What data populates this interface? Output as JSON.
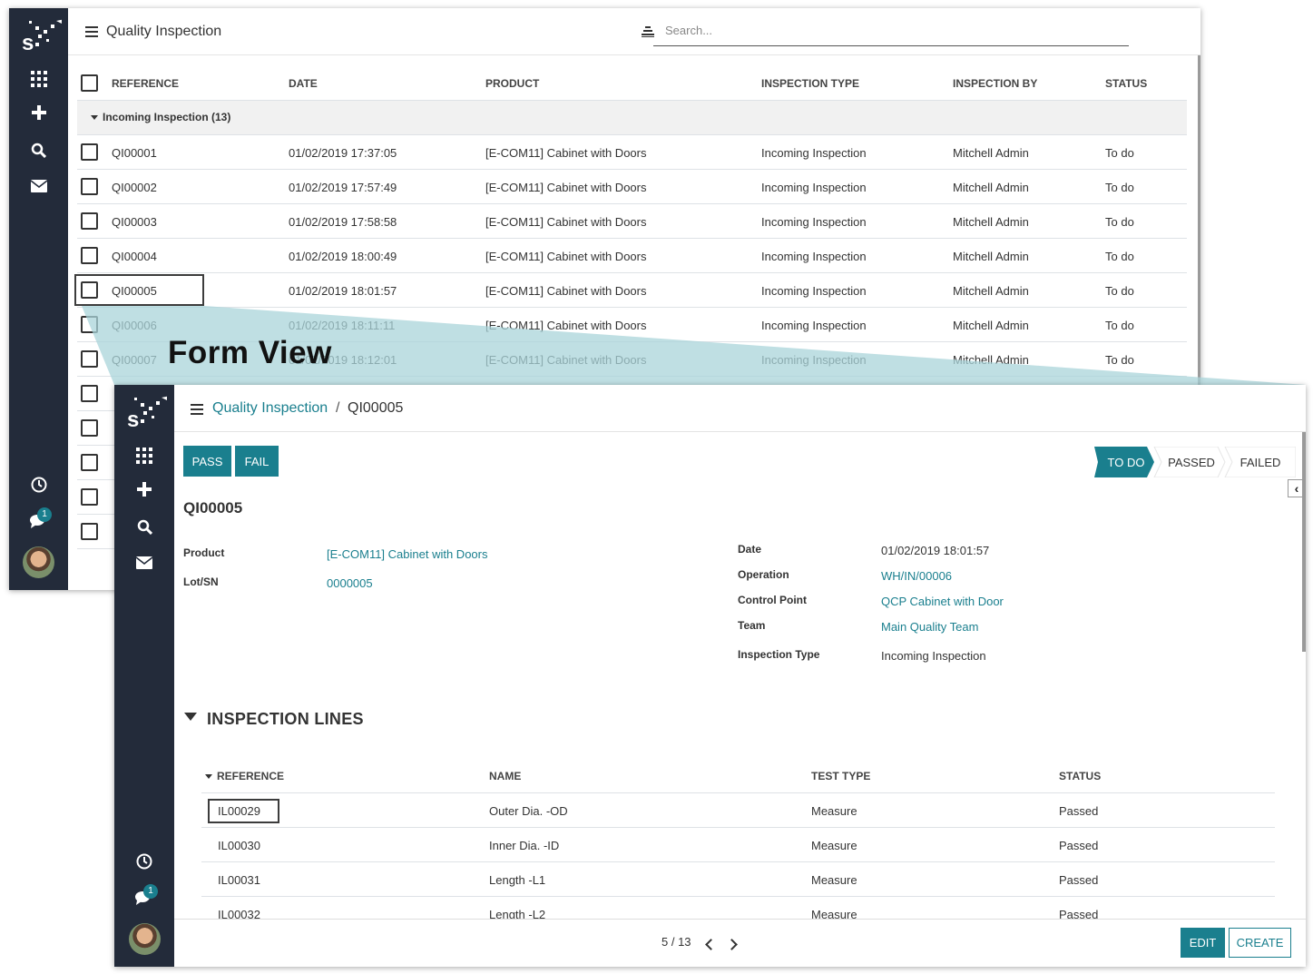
{
  "list_view": {
    "title": "Quality Inspection",
    "search_placeholder": "Search...",
    "columns": [
      "REFERENCE",
      "DATE",
      "PRODUCT",
      "INSPECTION TYPE",
      "INSPECTION BY",
      "STATUS"
    ],
    "group_label": "Incoming Inspection (13)",
    "rows": [
      {
        "ref": "QI00001",
        "date": "01/02/2019 17:37:05",
        "product": "[E-COM11] Cabinet with Doors",
        "type": "Incoming Inspection",
        "by": "Mitchell Admin",
        "status": "To do"
      },
      {
        "ref": "QI00002",
        "date": "01/02/2019 17:57:49",
        "product": "[E-COM11] Cabinet with Doors",
        "type": "Incoming Inspection",
        "by": "Mitchell Admin",
        "status": "To do"
      },
      {
        "ref": "QI00003",
        "date": "01/02/2019 17:58:58",
        "product": "[E-COM11] Cabinet with Doors",
        "type": "Incoming Inspection",
        "by": "Mitchell Admin",
        "status": "To do"
      },
      {
        "ref": "QI00004",
        "date": "01/02/2019 18:00:49",
        "product": "[E-COM11] Cabinet with Doors",
        "type": "Incoming Inspection",
        "by": "Mitchell Admin",
        "status": "To do"
      },
      {
        "ref": "QI00005",
        "date": "01/02/2019 18:01:57",
        "product": "[E-COM11] Cabinet with Doors",
        "type": "Incoming Inspection",
        "by": "Mitchell Admin",
        "status": "To do"
      },
      {
        "ref": "QI00006",
        "date": "01/02/2019 18:11:11",
        "product": "[E-COM11] Cabinet with Doors",
        "type": "Incoming Inspection",
        "by": "Mitchell Admin",
        "status": "To do"
      },
      {
        "ref": "QI00007",
        "date": "01/02/2019 18:12:01",
        "product": "[E-COM11] Cabinet with Doors",
        "type": "Incoming Inspection",
        "by": "Mitchell Admin",
        "status": "To do"
      }
    ],
    "chat_badge": "1"
  },
  "callout": {
    "label": "Form View"
  },
  "form_view": {
    "breadcrumb_parent": "Quality Inspection",
    "breadcrumb_sep": "/",
    "breadcrumb_current": "QI00005",
    "pass_label": "PASS",
    "fail_label": "FAIL",
    "statusbar": [
      "TO DO",
      "PASSED",
      "FAILED"
    ],
    "record_title": "QI00005",
    "fields_left": [
      {
        "label": "Product",
        "value": "[E-COM11] Cabinet with Doors"
      },
      {
        "label": "Lot/SN",
        "value": "0000005"
      }
    ],
    "fields_right": [
      {
        "label": "Date",
        "value": "01/02/2019 18:01:57"
      },
      {
        "label": "Operation",
        "value": "WH/IN/00006"
      },
      {
        "label": "Control Point",
        "value": "QCP Cabinet with Door"
      },
      {
        "label": "Team",
        "value": "Main Quality Team"
      },
      {
        "label": "Inspection Type",
        "value": "Incoming Inspection"
      }
    ],
    "lines_title": "INSPECTION LINES",
    "lines_columns": [
      "REFERENCE",
      "NAME",
      "TEST TYPE",
      "STATUS"
    ],
    "lines": [
      {
        "ref": "IL00029",
        "name": "Outer Dia. -OD",
        "test": "Measure",
        "status": "Passed"
      },
      {
        "ref": "IL00030",
        "name": "Inner Dia. -ID",
        "test": "Measure",
        "status": "Passed"
      },
      {
        "ref": "IL00031",
        "name": "Length -L1",
        "test": "Measure",
        "status": "Passed"
      },
      {
        "ref": "IL00032",
        "name": "Length -L2",
        "test": "Measure",
        "status": "Passed"
      }
    ],
    "pager": "5 / 13",
    "edit_label": "EDIT",
    "create_label": "CREATE",
    "chat_badge": "1"
  },
  "colors": {
    "accent": "#1a7f8e",
    "sidebar": "#232b3a",
    "connector": "#a9d4d9"
  }
}
